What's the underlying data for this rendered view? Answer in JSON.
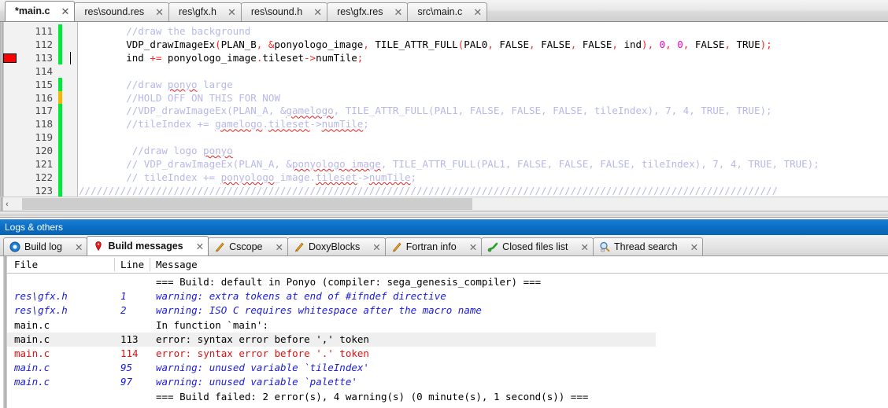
{
  "editor": {
    "tabs": [
      {
        "label": "*main.c",
        "active": true
      },
      {
        "label": "res\\sound.res",
        "active": false
      },
      {
        "label": "res\\gfx.h",
        "active": false
      },
      {
        "label": "res\\sound.h",
        "active": false
      },
      {
        "label": "res\\gfx.res",
        "active": false
      },
      {
        "label": "src\\main.c",
        "active": false
      }
    ],
    "close_glyph": "✕",
    "lines": [
      {
        "num": "111",
        "marker": "green",
        "breakpoint": false,
        "tokens": [
          {
            "t": "        ",
            "c": "c-plain"
          },
          {
            "t": "//draw the background",
            "c": "c-com"
          }
        ]
      },
      {
        "num": "112",
        "marker": "green",
        "breakpoint": false,
        "tokens": [
          {
            "t": "        ",
            "c": "c-plain"
          },
          {
            "t": "VDP_drawImageEx",
            "c": "c-plain"
          },
          {
            "t": "(",
            "c": "c-op"
          },
          {
            "t": "PLAN_B",
            "c": "c-plain"
          },
          {
            "t": ",",
            "c": "c-op"
          },
          {
            "t": " ",
            "c": "c-plain"
          },
          {
            "t": "&",
            "c": "c-op"
          },
          {
            "t": "ponyologo_image",
            "c": "c-plain"
          },
          {
            "t": ",",
            "c": "c-op"
          },
          {
            "t": " TILE_ATTR_FULL",
            "c": "c-plain"
          },
          {
            "t": "(",
            "c": "c-op"
          },
          {
            "t": "PAL0",
            "c": "c-plain"
          },
          {
            "t": ",",
            "c": "c-op"
          },
          {
            "t": " FALSE",
            "c": "c-plain"
          },
          {
            "t": ",",
            "c": "c-op"
          },
          {
            "t": " FALSE",
            "c": "c-plain"
          },
          {
            "t": ",",
            "c": "c-op"
          },
          {
            "t": " FALSE",
            "c": "c-plain"
          },
          {
            "t": ",",
            "c": "c-op"
          },
          {
            "t": " ind",
            "c": "c-plain"
          },
          {
            "t": "),",
            "c": "c-op"
          },
          {
            "t": " 0",
            "c": "c-num"
          },
          {
            "t": ",",
            "c": "c-op"
          },
          {
            "t": " 0",
            "c": "c-num"
          },
          {
            "t": ",",
            "c": "c-op"
          },
          {
            "t": " FALSE",
            "c": "c-plain"
          },
          {
            "t": ",",
            "c": "c-op"
          },
          {
            "t": " TRUE",
            "c": "c-plain"
          },
          {
            "t": ");",
            "c": "c-op"
          }
        ]
      },
      {
        "num": "113",
        "marker": "green",
        "breakpoint": true,
        "tokens": [
          {
            "t": "        ",
            "c": "c-plain"
          },
          {
            "t": "ind ",
            "c": "c-plain"
          },
          {
            "t": "+=",
            "c": "c-op"
          },
          {
            "t": " ponyologo_image",
            "c": "c-plain"
          },
          {
            "t": ".",
            "c": "c-op"
          },
          {
            "t": "tileset",
            "c": "c-plain"
          },
          {
            "t": "->",
            "c": "c-op"
          },
          {
            "t": "numTile",
            "c": "c-plain"
          },
          {
            "t": ";",
            "c": "c-op"
          }
        ]
      },
      {
        "num": "114",
        "marker": "none",
        "breakpoint": false,
        "tokens": []
      },
      {
        "num": "115",
        "marker": "green",
        "breakpoint": false,
        "tokens": [
          {
            "t": "        ",
            "c": "c-plain"
          },
          {
            "t": "//draw ",
            "c": "c-com"
          },
          {
            "t": "ponyo",
            "c": "c-com sq-wave"
          },
          {
            "t": " large",
            "c": "c-com"
          }
        ]
      },
      {
        "num": "116",
        "marker": "yellow",
        "breakpoint": false,
        "tokens": [
          {
            "t": "        ",
            "c": "c-plain"
          },
          {
            "t": "//HOLD OFF ON THIS FOR NOW",
            "c": "c-com"
          }
        ]
      },
      {
        "num": "117",
        "marker": "green",
        "breakpoint": false,
        "tokens": [
          {
            "t": "        ",
            "c": "c-plain"
          },
          {
            "t": "//VDP_drawImageEx(PLAN_A, &",
            "c": "c-com"
          },
          {
            "t": "gamelogo",
            "c": "c-com sq-wave"
          },
          {
            "t": ", TILE_ATTR_FULL(PAL1, FALSE, FALSE, FALSE, tileIndex), 7, 4, TRUE, TRUE);",
            "c": "c-com"
          }
        ]
      },
      {
        "num": "118",
        "marker": "green",
        "breakpoint": false,
        "tokens": [
          {
            "t": "        ",
            "c": "c-plain"
          },
          {
            "t": "//tileIndex += ",
            "c": "c-com"
          },
          {
            "t": "gamelogo",
            "c": "c-com sq-wave"
          },
          {
            "t": ".",
            "c": "c-com"
          },
          {
            "t": "tileset",
            "c": "c-com sq-wave"
          },
          {
            "t": "->",
            "c": "c-com"
          },
          {
            "t": "numTile",
            "c": "c-com sq-wave"
          },
          {
            "t": ";",
            "c": "c-com"
          }
        ]
      },
      {
        "num": "119",
        "marker": "green",
        "breakpoint": false,
        "tokens": []
      },
      {
        "num": "120",
        "marker": "green",
        "breakpoint": false,
        "tokens": [
          {
            "t": "         ",
            "c": "c-plain"
          },
          {
            "t": "//draw logo ",
            "c": "c-com"
          },
          {
            "t": "ponyo",
            "c": "c-com sq-wave"
          }
        ]
      },
      {
        "num": "121",
        "marker": "green",
        "breakpoint": false,
        "tokens": [
          {
            "t": "        ",
            "c": "c-plain"
          },
          {
            "t": "// VDP_drawImageEx(PLAN_A, &",
            "c": "c-com"
          },
          {
            "t": "ponyologo_image",
            "c": "c-com sq-wave"
          },
          {
            "t": ", TILE_ATTR_FULL(PAL1, FALSE, FALSE, FALSE, tileIndex), 7, 4, TRUE, TRUE);",
            "c": "c-com"
          }
        ]
      },
      {
        "num": "122",
        "marker": "green",
        "breakpoint": false,
        "tokens": [
          {
            "t": "        ",
            "c": "c-plain"
          },
          {
            "t": "// tileIndex += ",
            "c": "c-com"
          },
          {
            "t": "ponyologo",
            "c": "c-com sq-wave"
          },
          {
            "t": "_image",
            "c": "c-com"
          },
          {
            "t": ".",
            "c": "c-com"
          },
          {
            "t": "tileset",
            "c": "c-com sq-wave"
          },
          {
            "t": "->",
            "c": "c-com"
          },
          {
            "t": "numTile",
            "c": "c-com sq-wave"
          },
          {
            "t": ";",
            "c": "c-com"
          }
        ]
      },
      {
        "num": "123",
        "marker": "green",
        "breakpoint": false,
        "tokens": [
          {
            "t": "//////////////////////////////////////////////////////////////////////////////////////////////////////////////////////",
            "c": "c-com"
          }
        ]
      }
    ]
  },
  "scrollbar": {
    "left_arrow": "‹"
  },
  "logs_panel": {
    "title": "Logs & others",
    "close_glyph": "✕",
    "tabs": [
      {
        "label": "Build log",
        "icon": "gear-blue-icon",
        "active": false
      },
      {
        "label": "Build messages",
        "icon": "pin-red-icon",
        "active": true
      },
      {
        "label": "Cscope",
        "icon": "pencil-icon",
        "active": false
      },
      {
        "label": "DoxyBlocks",
        "icon": "pencil-icon",
        "active": false
      },
      {
        "label": "Fortran info",
        "icon": "pencil-icon",
        "active": false
      },
      {
        "label": "Closed files list",
        "icon": "plug-green-icon",
        "active": false
      },
      {
        "label": "Thread search",
        "icon": "magnifier-icon",
        "active": false
      }
    ],
    "columns": [
      "File",
      "Line",
      "Message"
    ],
    "rows": [
      {
        "file": "",
        "line": "",
        "message": "=== Build: default in Ponyo (compiler: sega_genesis_compiler) ===",
        "kind": "normal",
        "selected": false
      },
      {
        "file": "res\\gfx.h",
        "line": "1",
        "message": "warning: extra tokens at end of #ifndef directive",
        "kind": "warning",
        "selected": false
      },
      {
        "file": "res\\gfx.h",
        "line": "2",
        "message": "warning: ISO C requires whitespace after the macro name",
        "kind": "warning",
        "selected": false
      },
      {
        "file": "main.c",
        "line": "",
        "message": "In function `main':",
        "kind": "normal",
        "selected": false
      },
      {
        "file": "main.c",
        "line": "113",
        "message": "error: syntax error before ',' token",
        "kind": "errorsel",
        "selected": true
      },
      {
        "file": "main.c",
        "line": "114",
        "message": "error: syntax error before '.' token",
        "kind": "error",
        "selected": false
      },
      {
        "file": "main.c",
        "line": "95",
        "message": "warning: unused variable `tileIndex'",
        "kind": "warning",
        "selected": false
      },
      {
        "file": "main.c",
        "line": "97",
        "message": "warning: unused variable `palette'",
        "kind": "warning",
        "selected": false
      },
      {
        "file": "",
        "line": "",
        "message": "=== Build failed: 2 error(s), 4 warning(s) (0 minute(s), 1 second(s)) ===",
        "kind": "normal",
        "selected": false
      }
    ]
  },
  "colors": {
    "comment": "#b6b8e8",
    "operator": "#ff2222",
    "number": "#ff00c8",
    "warning": "#1a1ae0",
    "error": "#e01010",
    "marker_green": "#00e83c",
    "marker_yellow": "#f2b705",
    "breakpoint": "#ff0000",
    "panel_title_bg": "#0b6ec4"
  }
}
